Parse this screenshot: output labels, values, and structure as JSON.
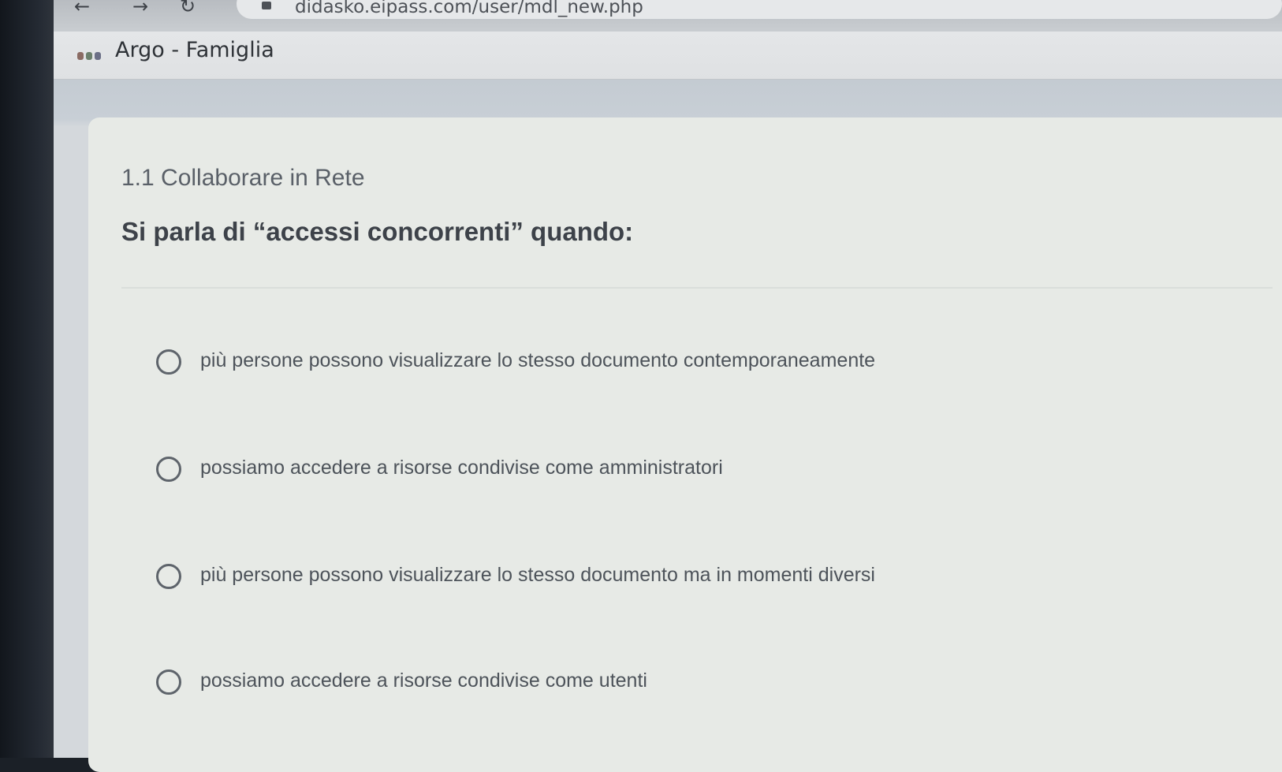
{
  "browser": {
    "url": "didasko.eipass.com/user/mdl_new.php",
    "bookmark_label": "Argo - Famiglia"
  },
  "quiz": {
    "section_title": "1.1 Collaborare in Rete",
    "question": "Si parla di “accessi concorrenti” quando:",
    "options": [
      "più persone possono visualizzare lo stesso documento contemporaneamente",
      "possiamo accedere a risorse condivise come amministratori",
      "più persone possono visualizzare lo stesso documento ma in momenti diversi",
      "possiamo accedere a risorse condivise come utenti"
    ]
  },
  "icons": {
    "back": "arrow-left-icon",
    "forward": "arrow-right-icon",
    "reload": "reload-icon",
    "bookmark_favicon": "argo-favicon-icon"
  },
  "colors": {
    "favicon": [
      "#c0392b",
      "#2e7d32",
      "#1565c0"
    ]
  }
}
